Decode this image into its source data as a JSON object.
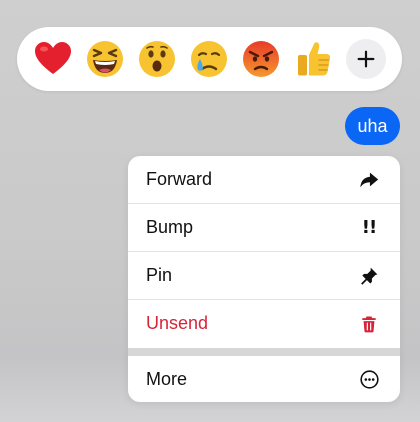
{
  "reactions": [
    {
      "name": "heart",
      "glyph": "❤️"
    },
    {
      "name": "laughing",
      "glyph": "😆"
    },
    {
      "name": "surprised",
      "glyph": "😮"
    },
    {
      "name": "crying",
      "glyph": "😢"
    },
    {
      "name": "angry",
      "glyph": "😡"
    },
    {
      "name": "thumbs-up",
      "glyph": "👍"
    }
  ],
  "add_reaction_icon": "plus-icon",
  "message": {
    "text": "uha",
    "bubble_color": "#0a66f4"
  },
  "menu": {
    "items": [
      {
        "label": "Forward",
        "icon": "forward-arrow-icon"
      },
      {
        "label": "Bump",
        "icon": "double-exclamation-icon",
        "glyph": "!!"
      },
      {
        "label": "Pin",
        "icon": "pin-icon"
      },
      {
        "label": "Unsend",
        "icon": "trash-icon",
        "color": "#d6253a"
      },
      {
        "label": "More",
        "icon": "more-circle-icon"
      }
    ]
  }
}
